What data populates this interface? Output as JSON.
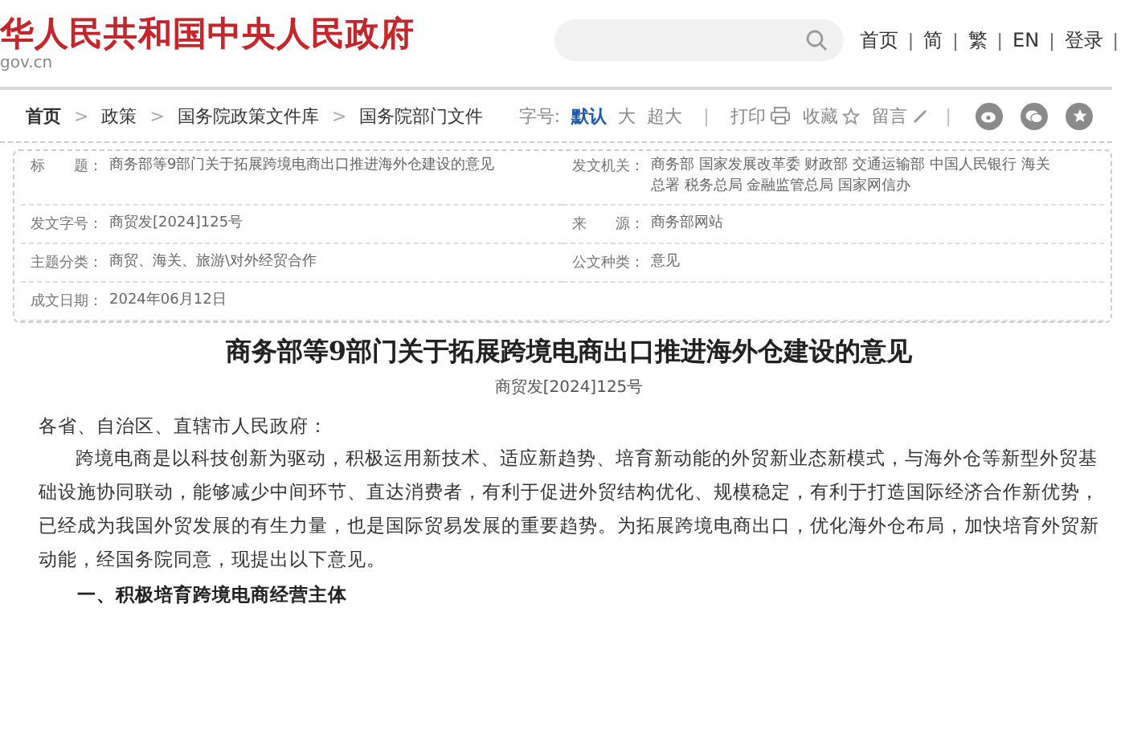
{
  "header": {
    "site_title": "华人民共和国中央人民政府",
    "domain": "gov.cn"
  },
  "top_links": {
    "separator": "|",
    "items": [
      "首页",
      "简",
      "繁",
      "EN",
      "登录"
    ]
  },
  "breadcrumb": {
    "separator": ">",
    "items": [
      "首页",
      "政策",
      "国务院政策文件库",
      "国务院部门文件"
    ]
  },
  "font_size": {
    "label": "字号:",
    "options": [
      {
        "label": "默认",
        "selected": true
      },
      {
        "label": "大",
        "selected": false
      },
      {
        "label": "超大",
        "selected": false
      }
    ]
  },
  "tools": [
    {
      "kind": "print",
      "label": "打印"
    },
    {
      "kind": "favorite",
      "label": "收藏"
    },
    {
      "kind": "comment",
      "label": "留言"
    }
  ],
  "metadata": [
    {
      "label": "标　　题：",
      "value": "商务部等9部门关于拓展跨境电商出口推进海外仓建设的意见"
    },
    {
      "label": "发文机关：",
      "value": "商务部 国家发展改革委 财政部 交通运输部 中国人民银行 海关总署 税务总局 金融监管总局 国家网信办"
    },
    {
      "label": "发文字号：",
      "value": "商贸发[2024]125号"
    },
    {
      "label": "来　　源：",
      "value": "商务部网站"
    },
    {
      "label": "主题分类：",
      "value": "商贸、海关、旅游\\对外经贸合作"
    },
    {
      "label": "公文种类：",
      "value": "意见"
    },
    {
      "label": "成文日期：",
      "value": "2024年06月12日"
    }
  ],
  "document": {
    "title": "商务部等9部门关于拓展跨境电商出口推进海外仓建设的意见",
    "number": "商贸发[2024]125号",
    "salutation": "各省、自治区、直辖市人民政府：",
    "paragraphs": [
      "跨境电商是以科技创新为驱动，积极运用新技术、适应新趋势、培育新动能的外贸新业态新模式，与海外仓等新型外贸基础设施协同联动，能够减少中间环节、直达消费者，有利于促进外贸结构优化、规模稳定，有利于打造国际经济合作新优势，已经成为我国外贸发展的有生力量，也是国际贸易发展的重要趋势。为拓展跨境电商出口，优化海外仓布局，加快培育外贸新动能，经国务院同意，现提出以下意见。"
    ],
    "section_heading": "一、积极培育跨境电商经营主体"
  }
}
